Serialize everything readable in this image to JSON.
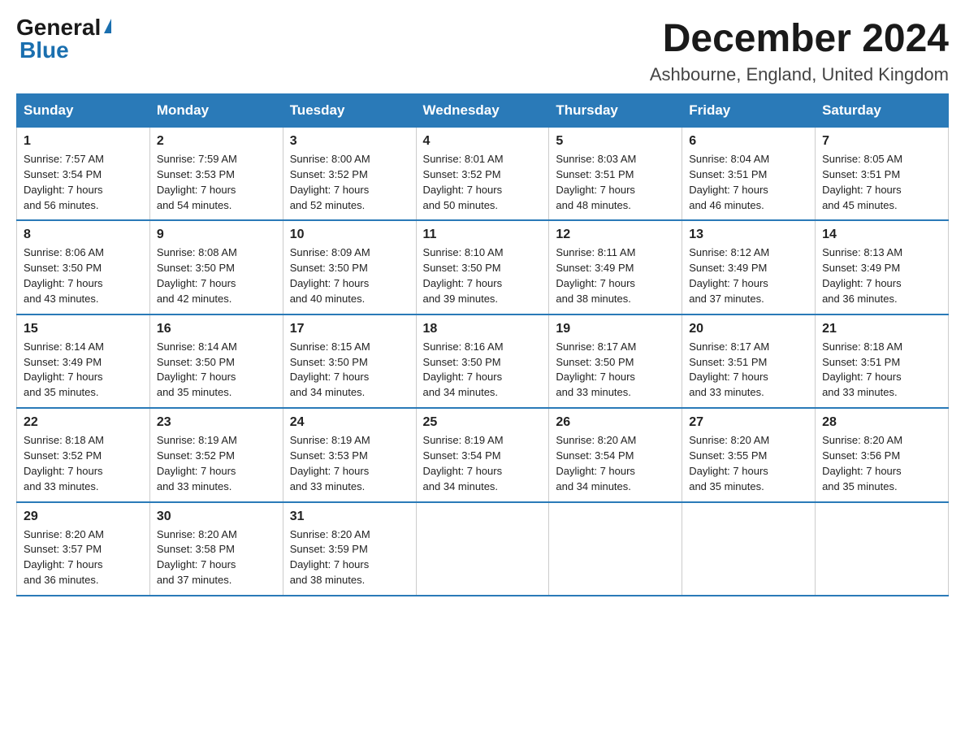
{
  "header": {
    "logo_general": "General",
    "logo_blue": "Blue",
    "month_title": "December 2024",
    "location": "Ashbourne, England, United Kingdom"
  },
  "days_of_week": [
    "Sunday",
    "Monday",
    "Tuesday",
    "Wednesday",
    "Thursday",
    "Friday",
    "Saturday"
  ],
  "weeks": [
    [
      {
        "num": "1",
        "sunrise": "7:57 AM",
        "sunset": "3:54 PM",
        "daylight": "7 hours and 56 minutes."
      },
      {
        "num": "2",
        "sunrise": "7:59 AM",
        "sunset": "3:53 PM",
        "daylight": "7 hours and 54 minutes."
      },
      {
        "num": "3",
        "sunrise": "8:00 AM",
        "sunset": "3:52 PM",
        "daylight": "7 hours and 52 minutes."
      },
      {
        "num": "4",
        "sunrise": "8:01 AM",
        "sunset": "3:52 PM",
        "daylight": "7 hours and 50 minutes."
      },
      {
        "num": "5",
        "sunrise": "8:03 AM",
        "sunset": "3:51 PM",
        "daylight": "7 hours and 48 minutes."
      },
      {
        "num": "6",
        "sunrise": "8:04 AM",
        "sunset": "3:51 PM",
        "daylight": "7 hours and 46 minutes."
      },
      {
        "num": "7",
        "sunrise": "8:05 AM",
        "sunset": "3:51 PM",
        "daylight": "7 hours and 45 minutes."
      }
    ],
    [
      {
        "num": "8",
        "sunrise": "8:06 AM",
        "sunset": "3:50 PM",
        "daylight": "7 hours and 43 minutes."
      },
      {
        "num": "9",
        "sunrise": "8:08 AM",
        "sunset": "3:50 PM",
        "daylight": "7 hours and 42 minutes."
      },
      {
        "num": "10",
        "sunrise": "8:09 AM",
        "sunset": "3:50 PM",
        "daylight": "7 hours and 40 minutes."
      },
      {
        "num": "11",
        "sunrise": "8:10 AM",
        "sunset": "3:50 PM",
        "daylight": "7 hours and 39 minutes."
      },
      {
        "num": "12",
        "sunrise": "8:11 AM",
        "sunset": "3:49 PM",
        "daylight": "7 hours and 38 minutes."
      },
      {
        "num": "13",
        "sunrise": "8:12 AM",
        "sunset": "3:49 PM",
        "daylight": "7 hours and 37 minutes."
      },
      {
        "num": "14",
        "sunrise": "8:13 AM",
        "sunset": "3:49 PM",
        "daylight": "7 hours and 36 minutes."
      }
    ],
    [
      {
        "num": "15",
        "sunrise": "8:14 AM",
        "sunset": "3:49 PM",
        "daylight": "7 hours and 35 minutes."
      },
      {
        "num": "16",
        "sunrise": "8:14 AM",
        "sunset": "3:50 PM",
        "daylight": "7 hours and 35 minutes."
      },
      {
        "num": "17",
        "sunrise": "8:15 AM",
        "sunset": "3:50 PM",
        "daylight": "7 hours and 34 minutes."
      },
      {
        "num": "18",
        "sunrise": "8:16 AM",
        "sunset": "3:50 PM",
        "daylight": "7 hours and 34 minutes."
      },
      {
        "num": "19",
        "sunrise": "8:17 AM",
        "sunset": "3:50 PM",
        "daylight": "7 hours and 33 minutes."
      },
      {
        "num": "20",
        "sunrise": "8:17 AM",
        "sunset": "3:51 PM",
        "daylight": "7 hours and 33 minutes."
      },
      {
        "num": "21",
        "sunrise": "8:18 AM",
        "sunset": "3:51 PM",
        "daylight": "7 hours and 33 minutes."
      }
    ],
    [
      {
        "num": "22",
        "sunrise": "8:18 AM",
        "sunset": "3:52 PM",
        "daylight": "7 hours and 33 minutes."
      },
      {
        "num": "23",
        "sunrise": "8:19 AM",
        "sunset": "3:52 PM",
        "daylight": "7 hours and 33 minutes."
      },
      {
        "num": "24",
        "sunrise": "8:19 AM",
        "sunset": "3:53 PM",
        "daylight": "7 hours and 33 minutes."
      },
      {
        "num": "25",
        "sunrise": "8:19 AM",
        "sunset": "3:54 PM",
        "daylight": "7 hours and 34 minutes."
      },
      {
        "num": "26",
        "sunrise": "8:20 AM",
        "sunset": "3:54 PM",
        "daylight": "7 hours and 34 minutes."
      },
      {
        "num": "27",
        "sunrise": "8:20 AM",
        "sunset": "3:55 PM",
        "daylight": "7 hours and 35 minutes."
      },
      {
        "num": "28",
        "sunrise": "8:20 AM",
        "sunset": "3:56 PM",
        "daylight": "7 hours and 35 minutes."
      }
    ],
    [
      {
        "num": "29",
        "sunrise": "8:20 AM",
        "sunset": "3:57 PM",
        "daylight": "7 hours and 36 minutes."
      },
      {
        "num": "30",
        "sunrise": "8:20 AM",
        "sunset": "3:58 PM",
        "daylight": "7 hours and 37 minutes."
      },
      {
        "num": "31",
        "sunrise": "8:20 AM",
        "sunset": "3:59 PM",
        "daylight": "7 hours and 38 minutes."
      },
      null,
      null,
      null,
      null
    ]
  ],
  "labels": {
    "sunrise": "Sunrise:",
    "sunset": "Sunset:",
    "daylight": "Daylight:"
  }
}
